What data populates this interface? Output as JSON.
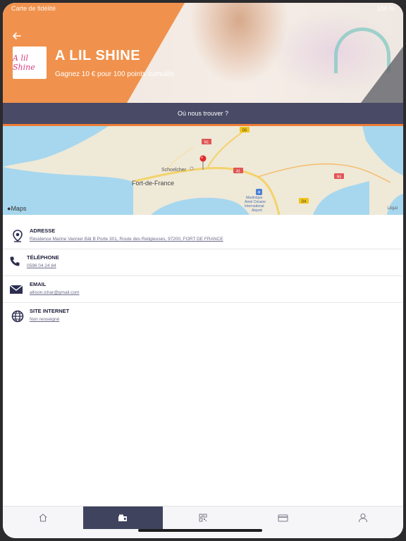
{
  "statusbar": {
    "left": "Carte de fidélité",
    "right": "100 %"
  },
  "header": {
    "title": "A LIL SHINE",
    "reward": "Gagnez 10 € pour 100 points cumulés",
    "logo_text": "A lil Shine",
    "back_icon": "arrow-left-icon"
  },
  "section": {
    "title": "Où nous trouver ?"
  },
  "map": {
    "labels": {
      "schoelcher": "Schoelcher",
      "fort_de_france": "Fort-de-France",
      "airport1": "Martinique",
      "airport2": "Aimé Césaire",
      "airport3": "International",
      "airport4": "Airport",
      "r1": "D5",
      "r2": "N1",
      "r3": "A1",
      "r4": "N5",
      "r5": "D4"
    },
    "attribution": "Maps",
    "legal": "Légal",
    "water_color": "#a6d7ee",
    "land_color": "#efe9d8",
    "road_color": "#f3d36a",
    "pin_color": "#e02b2b"
  },
  "contacts": [
    {
      "label": "ADRESSE",
      "value": "Résidence Marine Vannier Bât B Porte 301, Route des Religieuses, 97200, FORT DE FRANCE",
      "icon": "location-pin-icon"
    },
    {
      "label": "TÉLÉPHONE",
      "value": "0596 04 24 84",
      "icon": "phone-icon"
    },
    {
      "label": "EMAIL",
      "value": "allison.ichar@gmail.com",
      "icon": "envelope-icon"
    },
    {
      "label": "SITE INTERNET",
      "value": "Non renseigné",
      "icon": "globe-icon"
    }
  ],
  "tabs": [
    {
      "name": "home",
      "icon": "home-icon",
      "active": false
    },
    {
      "name": "stores",
      "icon": "store-icon",
      "active": true
    },
    {
      "name": "qr",
      "icon": "qr-code-icon",
      "active": false
    },
    {
      "name": "card",
      "icon": "card-icon",
      "active": false
    },
    {
      "name": "profile",
      "icon": "user-icon",
      "active": false
    }
  ],
  "colors": {
    "accent": "#ef7d35",
    "navy": "#484a66",
    "text": "#1d1d3a"
  }
}
